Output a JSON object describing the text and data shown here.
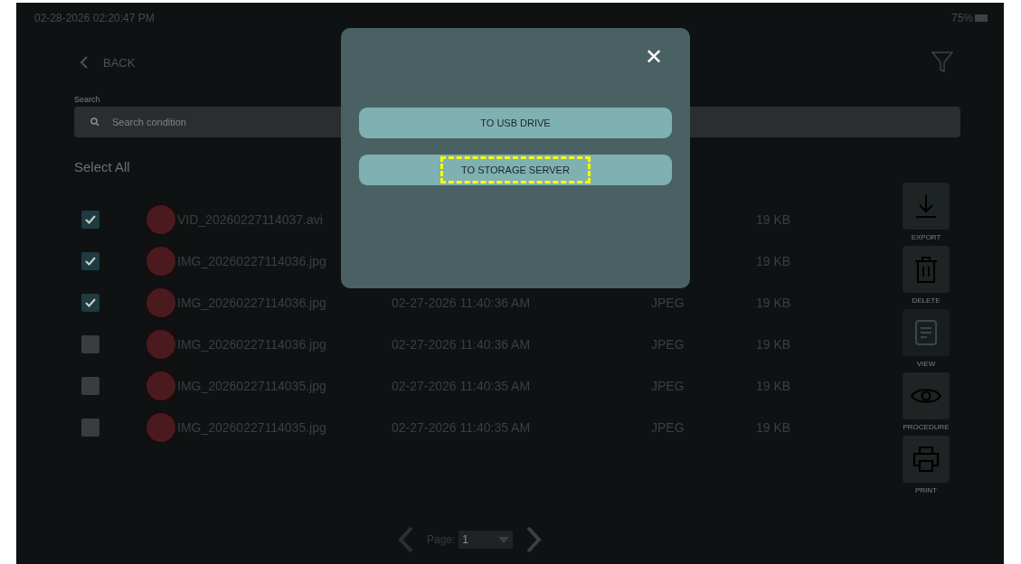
{
  "status_bar": {
    "datetime": "02-28-2026 02:20:47 PM",
    "battery_text": "75%"
  },
  "header": {
    "back_label": "BACK"
  },
  "search": {
    "label": "Search",
    "placeholder": "Search condition"
  },
  "select_all": "Select All",
  "rows": [
    {
      "checked": true,
      "name": "VID_20260227114037.avi",
      "size": "19 KB"
    },
    {
      "checked": true,
      "name": "IMG_20260227114036.jpg",
      "size": "19 KB"
    },
    {
      "checked": true,
      "name": "IMG_20260227114036.jpg",
      "date": "02-27-2026 11:40:36 AM",
      "type": "JPEG",
      "size": "19 KB"
    },
    {
      "checked": false,
      "name": "IMG_20260227114036.jpg",
      "date": "02-27-2026 11:40:36 AM",
      "type": "JPEG",
      "size": "19 KB"
    },
    {
      "checked": false,
      "name": "IMG_20260227114035.jpg",
      "date": "02-27-2026 11:40:35 AM",
      "type": "JPEG",
      "size": "19 KB"
    },
    {
      "checked": false,
      "name": "IMG_20260227114035.jpg",
      "date": "02-27-2026 11:40:35 AM",
      "type": "JPEG",
      "size": "19 KB"
    }
  ],
  "tools": [
    {
      "kind": "export",
      "label": "EXPORT",
      "disabled": false
    },
    {
      "kind": "delete",
      "label": "DELETE",
      "disabled": false
    },
    {
      "kind": "view",
      "label": "VIEW",
      "disabled": true
    },
    {
      "kind": "procedure",
      "label": "PROCEDURE",
      "disabled": false
    },
    {
      "kind": "print",
      "label": "PRINT",
      "disabled": false
    }
  ],
  "pagination": {
    "label": "Page:",
    "value": "1"
  },
  "dialog": {
    "close": "✕",
    "options": [
      {
        "label": "TO USB DRIVE",
        "highlighted": false
      },
      {
        "label": "TO STORAGE SERVER",
        "highlighted": true
      }
    ]
  }
}
